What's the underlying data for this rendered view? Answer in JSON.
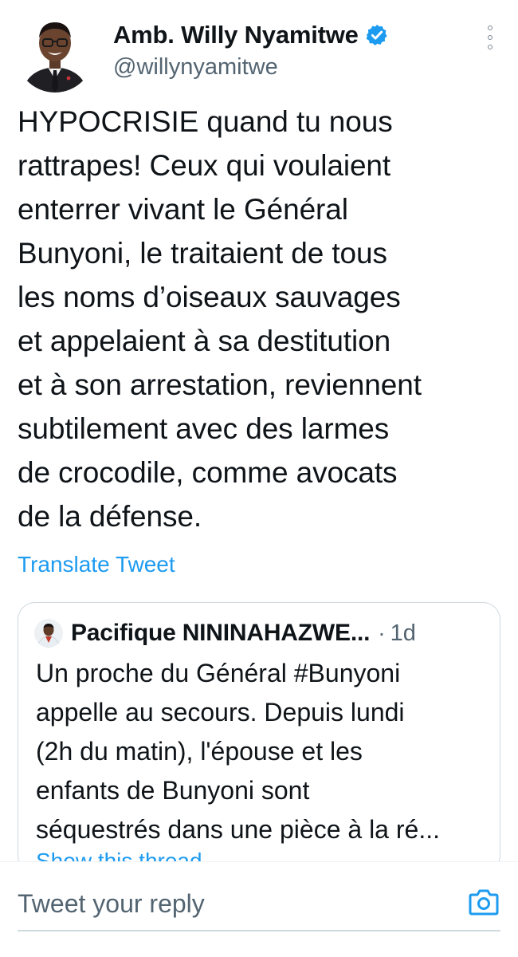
{
  "author": {
    "display_name": "Amb. Willy Nyamitwe",
    "handle": "@willynyamitwe",
    "verified": true,
    "icons": {
      "verified": "verified-badge-icon",
      "more": "more-options-icon"
    }
  },
  "tweet": {
    "text": "HYPOCRISIE quand tu nous\nrattrapes! Ceux qui voulaient\nenterrer vivant le Général\nBunyoni, le traitaient de tous\nles noms d’oiseaux sauvages\net appelaient à sa destitution\net à son arrestation, reviennent\nsubtilement avec des larmes\nde crocodile, comme avocats\nde la défense.",
    "translate_label": "Translate Tweet"
  },
  "quoted_tweet": {
    "author_name": "Pacifique NININAHAZWE...",
    "separator": "·",
    "time": "1d",
    "text": "Un proche du Général #Bunyoni\nappelle au secours. Depuis lundi\n(2h du matin), l'épouse et les\nenfants de Bunyoni sont\nséquestrés dans une pièce à la ré...",
    "show_thread_label": "Show this thread"
  },
  "reply": {
    "placeholder": "Tweet your reply",
    "camera_icon": "camera-icon"
  },
  "colors": {
    "accent": "#1d9bf0",
    "text_primary": "#0f1419",
    "text_secondary": "#536471",
    "border": "#cfd9de"
  }
}
